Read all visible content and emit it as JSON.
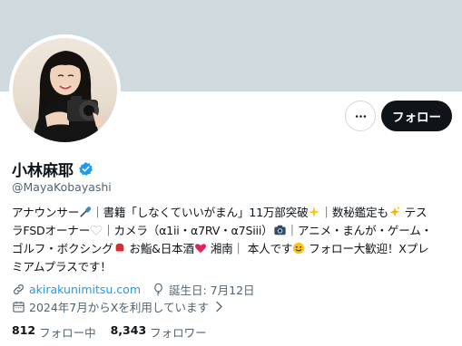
{
  "profile": {
    "display_name": "小林麻耶",
    "handle": "@MayaKobayashi",
    "bio_lines": [
      [
        "アナウンサー",
        "｜書籍「しなくていいがまん」11万部突破",
        "｜数秘鑑定も",
        " テス"
      ],
      [
        "ラFSDオーナー",
        "｜カメラ（α1ii・α7RV・α7Siii）",
        "｜アニメ・まんが・ゲーム・"
      ],
      [
        "ゴルフ・ボクシング",
        " お鮨&日本酒",
        " 湘南｜ 本人です",
        " フォロー大歓迎！Xプレ"
      ],
      [
        "ミアムプラスです！"
      ]
    ],
    "website": "akirakunimitsu.com",
    "birthday": "誕生日: 7月12日",
    "joined": "2024年7月からXを利用しています",
    "following_count": "812",
    "following_label": "フォロー中",
    "followers_count": "8,343",
    "followers_label": "フォロワー"
  },
  "actions": {
    "follow_label": "フォロー"
  },
  "icons": {
    "more": "more-icon",
    "verified": "verified-badge-icon",
    "link": "link-icon",
    "birthday": "balloon-icon",
    "joined": "calendar-icon",
    "joined_chevron": "chevron-right-icon"
  },
  "colors": {
    "banner": "#cfd9de",
    "accent": "#1d9bf0",
    "text": "#0f1419",
    "secondary": "#536471",
    "follow_bg": "#0f1419"
  }
}
